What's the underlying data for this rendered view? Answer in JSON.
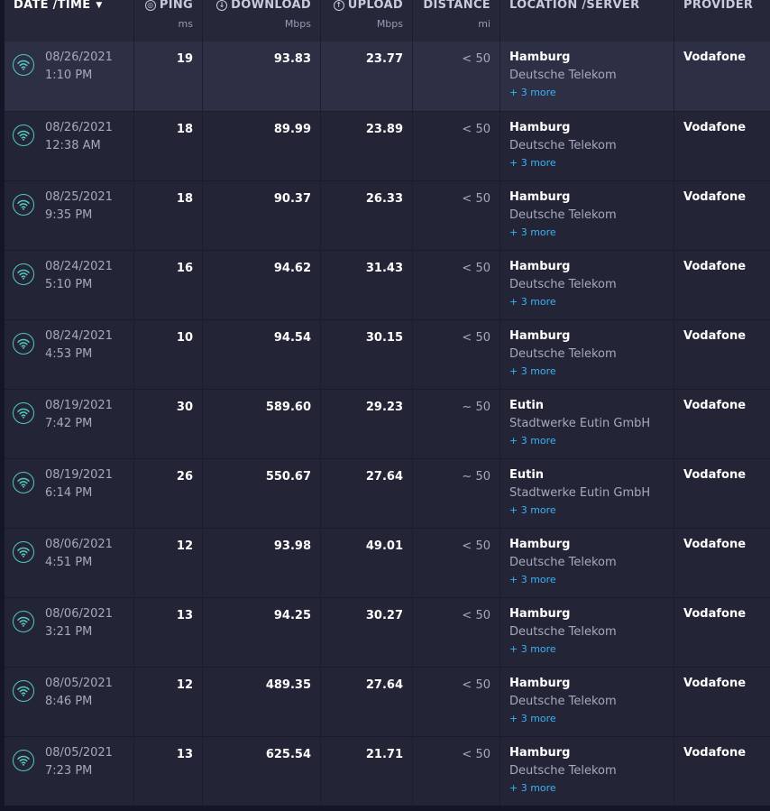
{
  "header": {
    "date": "DATE /TIME",
    "ping": "PING",
    "ping_unit": "ms",
    "download": "DOWNLOAD",
    "download_unit": "Mbps",
    "upload": "UPLOAD",
    "upload_unit": "Mbps",
    "distance": "DISTANCE",
    "distance_unit": "mi",
    "location": "LOCATION /SERVER",
    "provider": "PROVIDER"
  },
  "colors": {
    "background": "#232435",
    "highlight_row": "#2d2f44",
    "wifi_icon": "#57c7c1",
    "link": "#3bb2f5"
  },
  "icons": {
    "connection": "wifi-icon",
    "ping": "ping-icon",
    "download": "download-arrow-icon",
    "upload": "upload-arrow-icon",
    "sort": "caret-down-icon"
  },
  "rows": [
    {
      "date": "08/26/2021",
      "time": "1:10 PM",
      "ping": "19",
      "download": "93.83",
      "upload": "23.77",
      "distance": "< 50",
      "city": "Hamburg",
      "server": "Deutsche Telekom",
      "more": "+ 3 more",
      "provider": "Vodafone"
    },
    {
      "date": "08/26/2021",
      "time": "12:38 AM",
      "ping": "18",
      "download": "89.99",
      "upload": "23.89",
      "distance": "< 50",
      "city": "Hamburg",
      "server": "Deutsche Telekom",
      "more": "+ 3 more",
      "provider": "Vodafone"
    },
    {
      "date": "08/25/2021",
      "time": "9:35 PM",
      "ping": "18",
      "download": "90.37",
      "upload": "26.33",
      "distance": "< 50",
      "city": "Hamburg",
      "server": "Deutsche Telekom",
      "more": "+ 3 more",
      "provider": "Vodafone"
    },
    {
      "date": "08/24/2021",
      "time": "5:10 PM",
      "ping": "16",
      "download": "94.62",
      "upload": "31.43",
      "distance": "< 50",
      "city": "Hamburg",
      "server": "Deutsche Telekom",
      "more": "+ 3 more",
      "provider": "Vodafone"
    },
    {
      "date": "08/24/2021",
      "time": "4:53 PM",
      "ping": "10",
      "download": "94.54",
      "upload": "30.15",
      "distance": "< 50",
      "city": "Hamburg",
      "server": "Deutsche Telekom",
      "more": "+ 3 more",
      "provider": "Vodafone"
    },
    {
      "date": "08/19/2021",
      "time": "7:42 PM",
      "ping": "30",
      "download": "589.60",
      "upload": "29.23",
      "distance": "~ 50",
      "city": "Eutin",
      "server": "Stadtwerke Eutin GmbH",
      "more": "+ 3 more",
      "provider": "Vodafone"
    },
    {
      "date": "08/19/2021",
      "time": "6:14 PM",
      "ping": "26",
      "download": "550.67",
      "upload": "27.64",
      "distance": "~ 50",
      "city": "Eutin",
      "server": "Stadtwerke Eutin GmbH",
      "more": "+ 3 more",
      "provider": "Vodafone"
    },
    {
      "date": "08/06/2021",
      "time": "4:51 PM",
      "ping": "12",
      "download": "93.98",
      "upload": "49.01",
      "distance": "< 50",
      "city": "Hamburg",
      "server": "Deutsche Telekom",
      "more": "+ 3 more",
      "provider": "Vodafone"
    },
    {
      "date": "08/06/2021",
      "time": "3:21 PM",
      "ping": "13",
      "download": "94.25",
      "upload": "30.27",
      "distance": "< 50",
      "city": "Hamburg",
      "server": "Deutsche Telekom",
      "more": "+ 3 more",
      "provider": "Vodafone"
    },
    {
      "date": "08/05/2021",
      "time": "8:46 PM",
      "ping": "12",
      "download": "489.35",
      "upload": "27.64",
      "distance": "< 50",
      "city": "Hamburg",
      "server": "Deutsche Telekom",
      "more": "+ 3 more",
      "provider": "Vodafone"
    },
    {
      "date": "08/05/2021",
      "time": "7:23 PM",
      "ping": "13",
      "download": "625.54",
      "upload": "21.71",
      "distance": "< 50",
      "city": "Hamburg",
      "server": "Deutsche Telekom",
      "more": "+ 3 more",
      "provider": "Vodafone"
    }
  ]
}
